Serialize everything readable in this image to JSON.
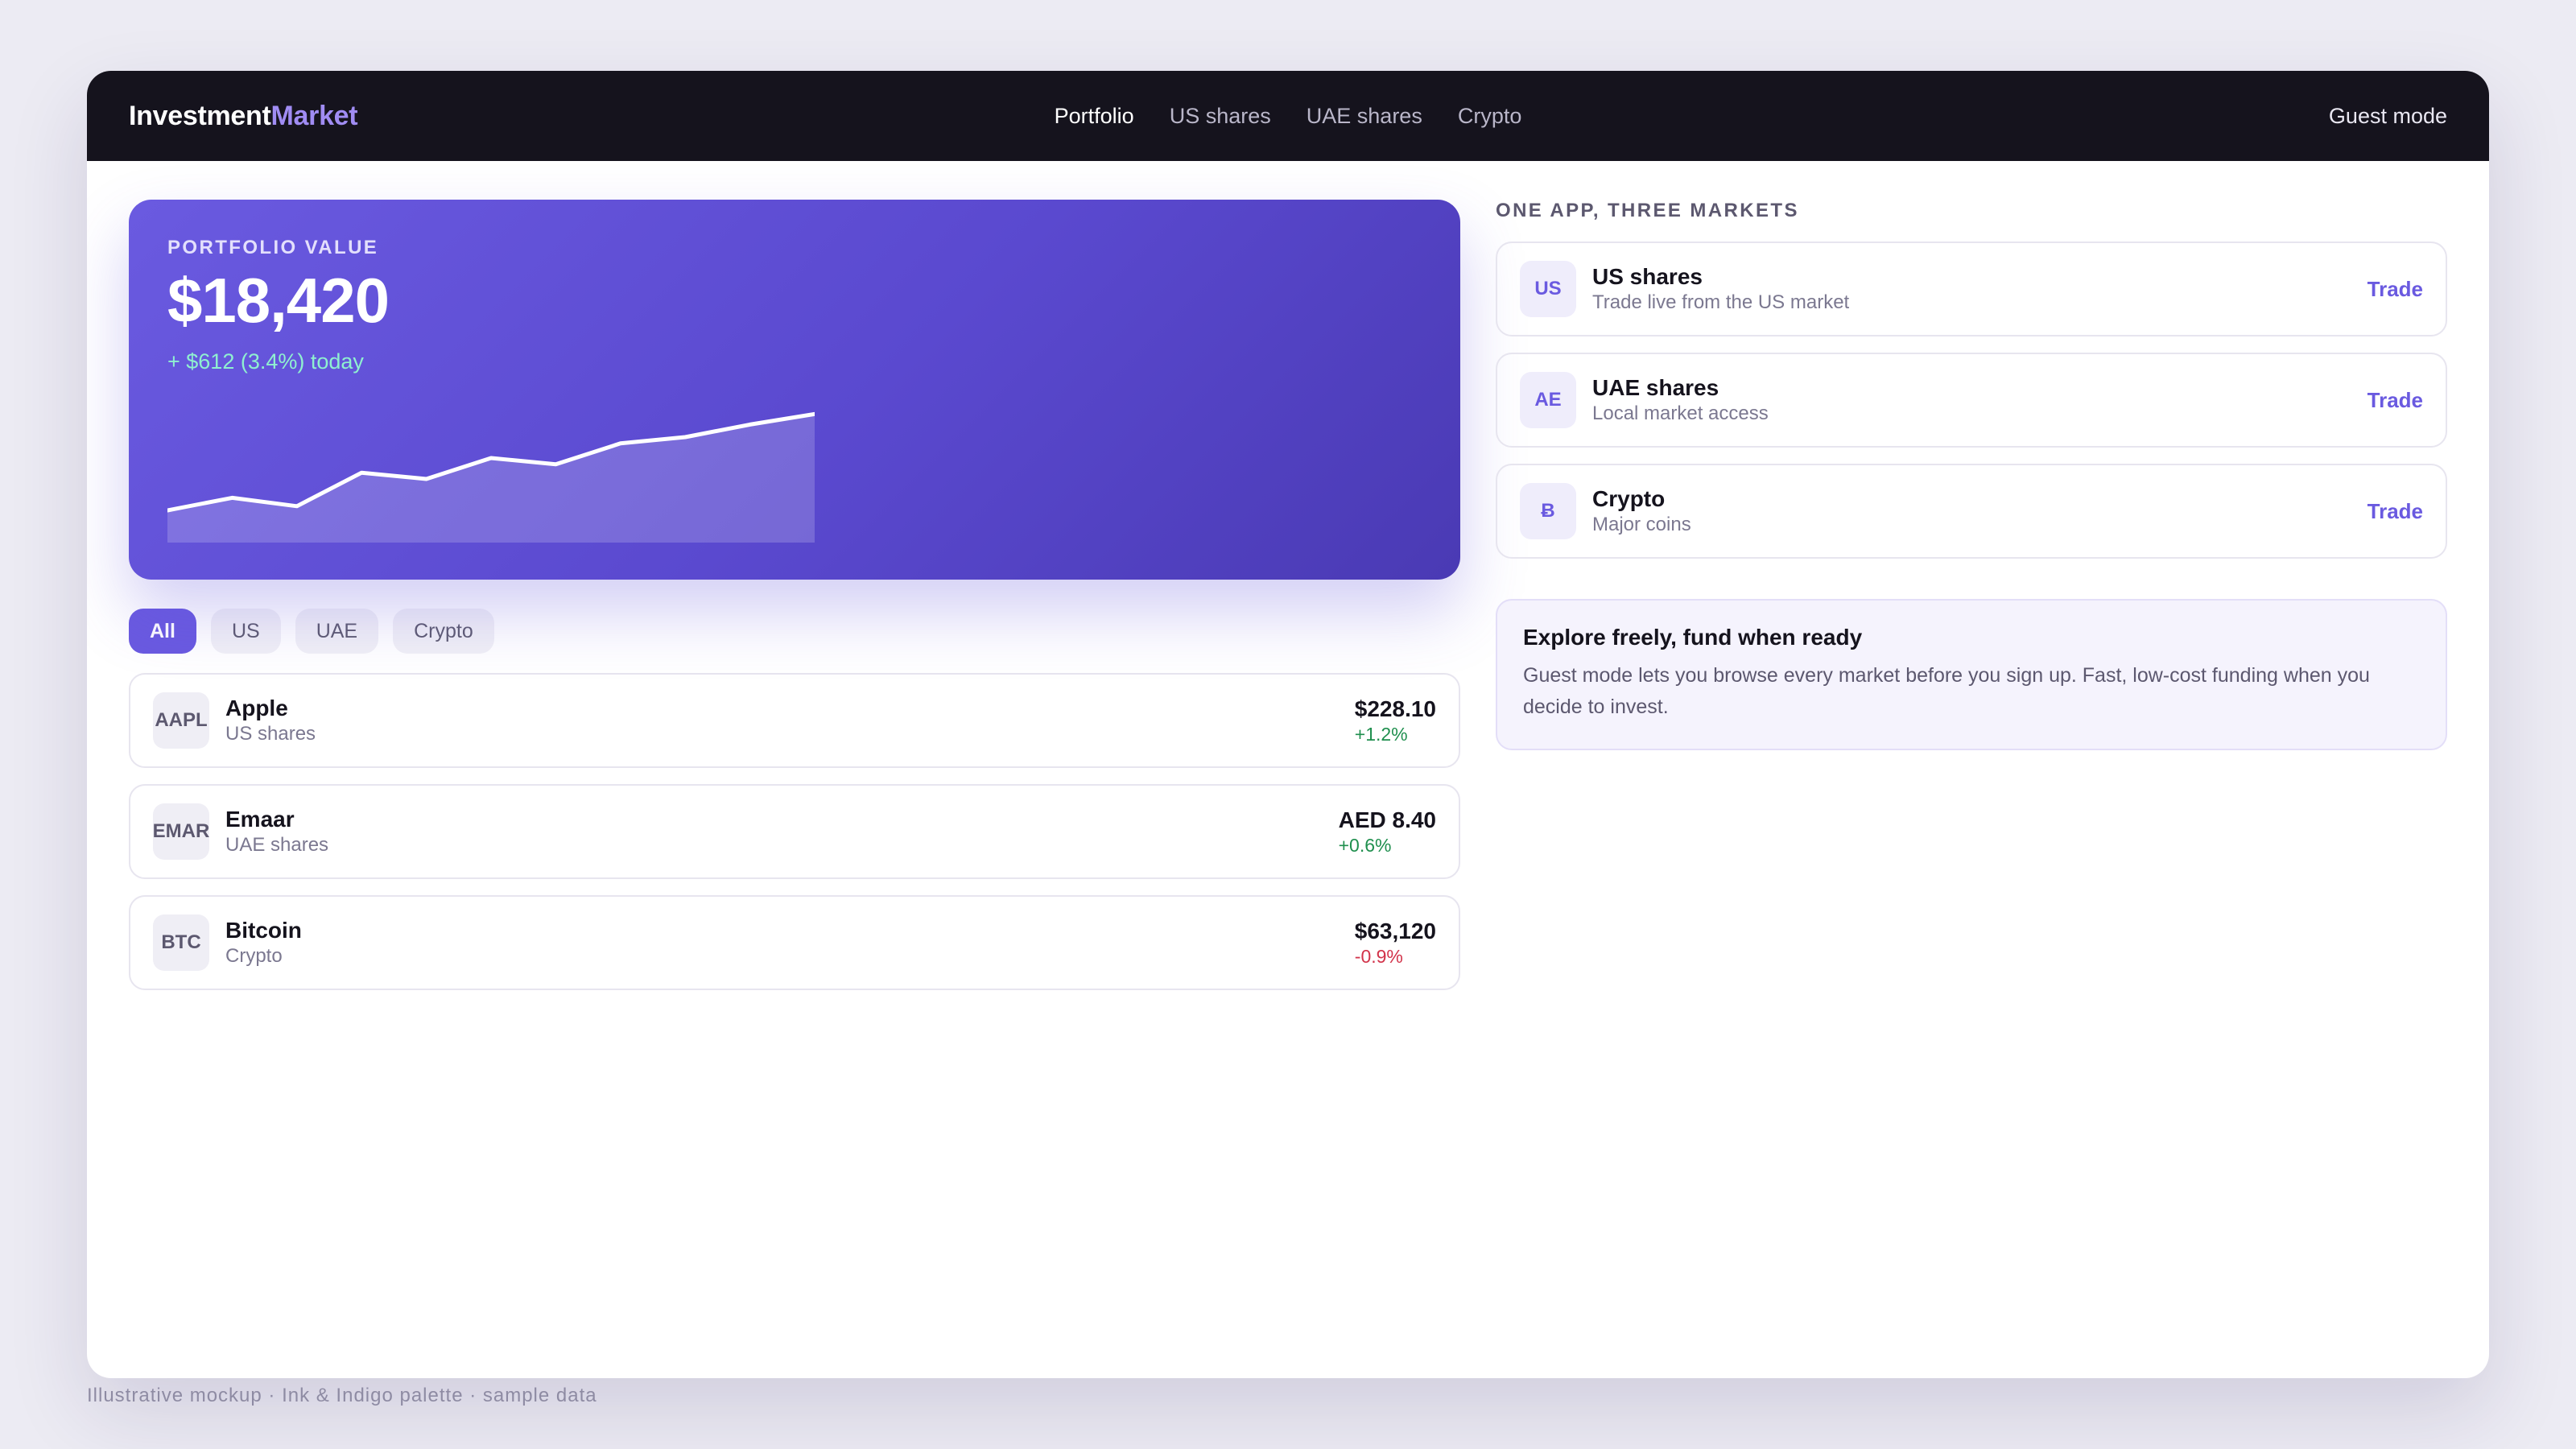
{
  "brand": {
    "primary": "Investment",
    "accent": "Market"
  },
  "nav": [
    {
      "label": "Portfolio",
      "active": true
    },
    {
      "label": "US shares",
      "active": false
    },
    {
      "label": "UAE shares",
      "active": false
    },
    {
      "label": "Crypto",
      "active": false
    }
  ],
  "guest_label": "Guest mode",
  "hero": {
    "label": "PORTFOLIO VALUE",
    "value": "$18,420",
    "change": "+ $612 (3.4%) today"
  },
  "sparkline": [
    0.0,
    0.12,
    0.04,
    0.36,
    0.3,
    0.5,
    0.44,
    0.64,
    0.7,
    0.82,
    0.92
  ],
  "filters": [
    {
      "label": "All",
      "active": true
    },
    {
      "label": "US",
      "active": false
    },
    {
      "label": "UAE",
      "active": false
    },
    {
      "label": "Crypto",
      "active": false
    }
  ],
  "holdings": [
    {
      "ticker": "AAPL",
      "name": "Apple",
      "market": "US shares",
      "price": "$228.10",
      "change": "+1.2%",
      "direction": "up"
    },
    {
      "ticker": "EMAR",
      "name": "Emaar",
      "market": "UAE shares",
      "price": "AED 8.40",
      "change": "+0.6%",
      "direction": "up"
    },
    {
      "ticker": "BTC",
      "name": "Bitcoin",
      "market": "Crypto",
      "price": "$63,120",
      "change": "-0.9%",
      "direction": "down"
    }
  ],
  "markets_title": "ONE APP, THREE MARKETS",
  "markets": [
    {
      "badge": "US",
      "name": "US shares",
      "desc": "Trade live from the US market",
      "action": "Trade"
    },
    {
      "badge": "AE",
      "name": "UAE shares",
      "desc": "Local market access",
      "action": "Trade"
    },
    {
      "badge": "Ƀ",
      "name": "Crypto",
      "desc": "Major coins",
      "action": "Trade"
    }
  ],
  "explore": {
    "title": "Explore freely, fund when ready",
    "body": "Guest mode lets you browse every market before you sign up. Fast, low-cost funding when you decide to invest."
  },
  "footnote": "Illustrative mockup · Ink & Indigo palette · sample data",
  "colors": {
    "ink": "#15131d",
    "indigo": "#6a5ae0",
    "up": "#1f8f4e",
    "down": "#d2334a"
  }
}
